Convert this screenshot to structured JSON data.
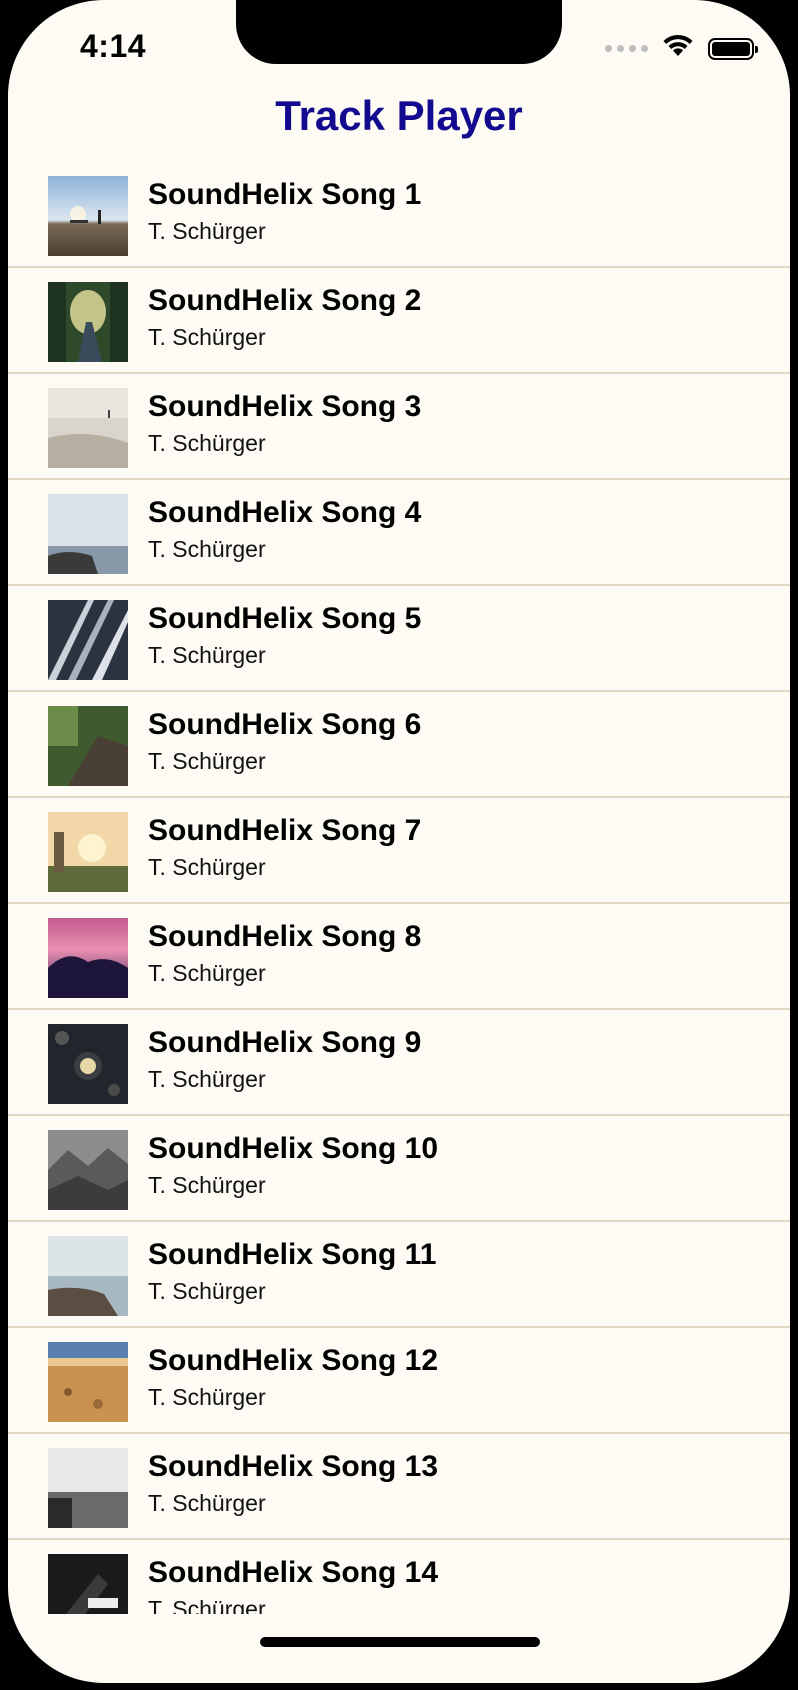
{
  "status_bar": {
    "time": "4:14",
    "icons": [
      "cellular-signal-icon",
      "wifi-icon",
      "battery-icon"
    ],
    "battery_level": 1.0
  },
  "header": {
    "title": "Track Player",
    "title_color": "#120A8F"
  },
  "colors": {
    "background": "#FDFBF3",
    "divider": "#E3DAC6",
    "text": "#000000"
  },
  "tracks": [
    {
      "title": "SoundHelix Song 1",
      "artist": "T. Schürger",
      "artwork": "beach-silhouette-artwork"
    },
    {
      "title": "SoundHelix Song 2",
      "artist": "T. Schürger",
      "artwork": "forest-road-artwork"
    },
    {
      "title": "SoundHelix Song 3",
      "artist": "T. Schürger",
      "artwork": "misty-beach-artwork"
    },
    {
      "title": "SoundHelix Song 4",
      "artist": "T. Schürger",
      "artwork": "rocky-shore-artwork"
    },
    {
      "title": "SoundHelix Song 5",
      "artist": "T. Schürger",
      "artwork": "bridge-cables-artwork"
    },
    {
      "title": "SoundHelix Song 6",
      "artist": "T. Schürger",
      "artwork": "forest-stairs-artwork"
    },
    {
      "title": "SoundHelix Song 7",
      "artist": "T. Schürger",
      "artwork": "sunset-field-artwork"
    },
    {
      "title": "SoundHelix Song 8",
      "artist": "T. Schürger",
      "artwork": "pink-sky-clouds-artwork"
    },
    {
      "title": "SoundHelix Song 9",
      "artist": "T. Schürger",
      "artwork": "dark-table-food-artwork"
    },
    {
      "title": "SoundHelix Song 10",
      "artist": "T. Schürger",
      "artwork": "foggy-forest-artwork"
    },
    {
      "title": "SoundHelix Song 11",
      "artist": "T. Schürger",
      "artwork": "rocky-coast-artwork"
    },
    {
      "title": "SoundHelix Song 12",
      "artist": "T. Schürger",
      "artwork": "pebble-beach-artwork"
    },
    {
      "title": "SoundHelix Song 13",
      "artist": "T. Schürger",
      "artwork": "bw-seascape-artwork"
    },
    {
      "title": "SoundHelix Song 14",
      "artist": "T. Schürger",
      "artwork": "dark-piano-artwork"
    }
  ]
}
